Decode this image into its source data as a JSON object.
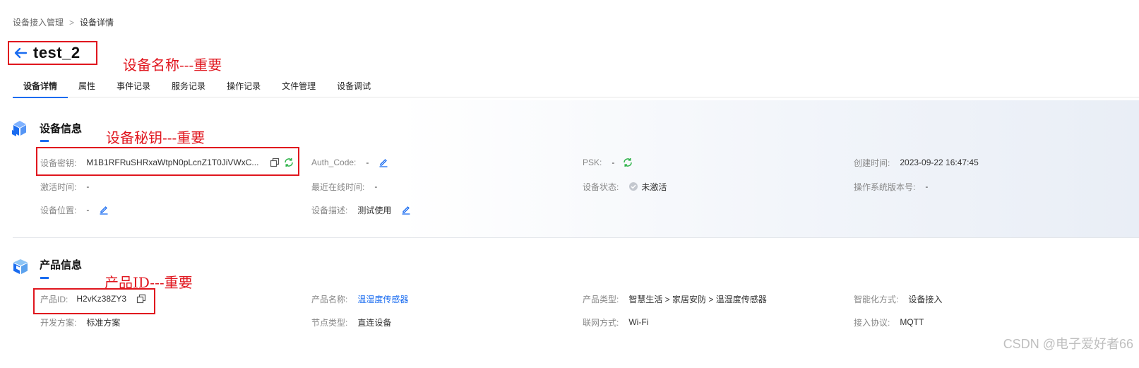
{
  "breadcrumb": {
    "parent": "设备接入管理",
    "separator": ">",
    "current": "设备详情"
  },
  "title": "test_2",
  "annotations": {
    "device_name": "设备名称---重要",
    "device_secret": "设备秘钥---重要",
    "product_id": "产品ID---重要"
  },
  "tabs": [
    "设备详情",
    "属性",
    "事件记录",
    "服务记录",
    "操作记录",
    "文件管理",
    "设备调试"
  ],
  "device_info": {
    "title": "设备信息",
    "secret": {
      "label": "设备密钥:",
      "value": "M1B1RFRuSHRxaWtpN0pLcnZ1T0JiVWxC..."
    },
    "auth_code": {
      "label": "Auth_Code:",
      "value": "-"
    },
    "psk": {
      "label": "PSK:",
      "value": "-"
    },
    "created": {
      "label": "创建时间:",
      "value": "2023-09-22 16:47:45"
    },
    "activated": {
      "label": "激活时间:",
      "value": "-"
    },
    "last_online": {
      "label": "最近在线时间:",
      "value": "-"
    },
    "status": {
      "label": "设备状态:",
      "value": "未激活"
    },
    "os_version": {
      "label": "操作系统版本号:",
      "value": "-"
    },
    "location": {
      "label": "设备位置:",
      "value": "-"
    },
    "description": {
      "label": "设备描述:",
      "value": "测试使用"
    }
  },
  "product_info": {
    "title": "产品信息",
    "id": {
      "label": "产品ID:",
      "value": "H2vKz38ZY3"
    },
    "name": {
      "label": "产品名称:",
      "value": "温湿度传感器"
    },
    "type": {
      "label": "产品类型:",
      "value": "智慧生活 > 家居安防 > 温湿度传感器"
    },
    "smart_mode": {
      "label": "智能化方式:",
      "value": "设备接入"
    },
    "dev_scheme": {
      "label": "开发方案:",
      "value": "标准方案"
    },
    "node_type": {
      "label": "节点类型:",
      "value": "直连设备"
    },
    "network": {
      "label": "联网方式:",
      "value": "Wi-Fi"
    },
    "protocol": {
      "label": "接入协议:",
      "value": "MQTT"
    }
  },
  "watermark": "CSDN @电子爱好者66",
  "colors": {
    "accent": "#1a6cf0",
    "annotation": "#e0161e",
    "refresh": "#2fb34a"
  }
}
